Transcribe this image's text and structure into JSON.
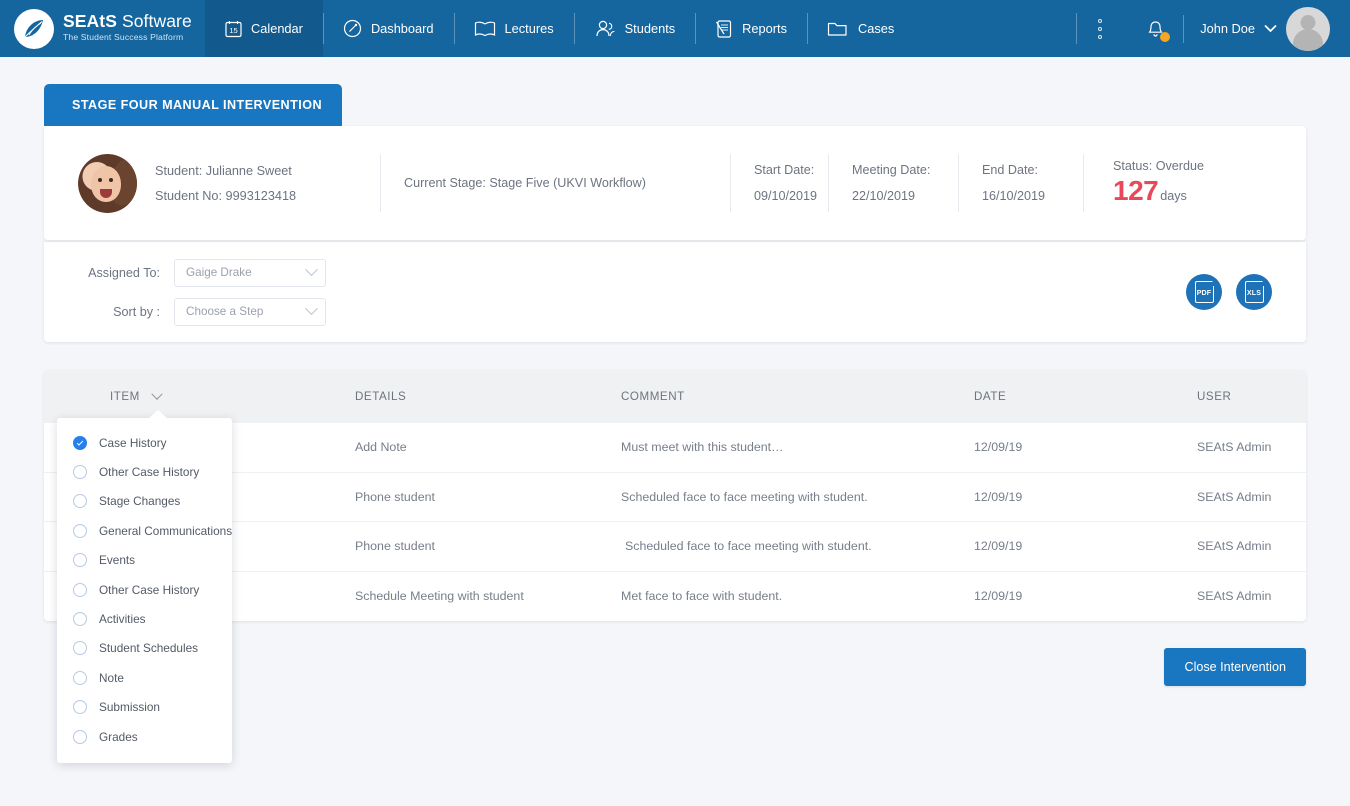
{
  "brand": {
    "name_bold": "SEAtS",
    "name_light": " Software",
    "tagline": "The Student Success Platform"
  },
  "nav": {
    "items": [
      {
        "label": "Calendar",
        "icon": "calendar-icon",
        "active": true
      },
      {
        "label": "Dashboard",
        "icon": "gauge-icon",
        "active": false
      },
      {
        "label": "Lectures",
        "icon": "book-icon",
        "active": false
      },
      {
        "label": "Students",
        "icon": "people-icon",
        "active": false
      },
      {
        "label": "Reports",
        "icon": "report-icon",
        "active": false
      },
      {
        "label": "Cases",
        "icon": "folder-icon",
        "active": false
      }
    ],
    "calendar_day": "15",
    "user_name": "John Doe",
    "accent_blue": "#15659f",
    "badge_color": "#f5a623"
  },
  "banner": {
    "title": "STAGE FOUR MANUAL INTERVENTION"
  },
  "student_info": {
    "student": "Student: Julianne Sweet",
    "student_no": "Student No: 9993123418",
    "current_stage": "Current Stage: Stage Five (UKVI Workflow)",
    "start_date_label": "Start Date:",
    "start_date": "09/10/2019",
    "meeting_date_label": "Meeting Date:",
    "meeting_date": "22/10/2019",
    "end_date_label": "End Date:",
    "end_date": "16/10/2019",
    "status_label": "Status: Overdue",
    "overdue_number": "127",
    "overdue_unit": "days",
    "overdue_color": "#e8495a"
  },
  "filters": {
    "assigned_to_label": "Assigned To:",
    "assigned_to_value": "Gaige Drake",
    "sort_by_label": "Sort by :",
    "sort_by_value": "Choose a Step",
    "export_pdf": "PDF",
    "export_xls": "XLS"
  },
  "table": {
    "columns": [
      "ITEM",
      "DETAILS",
      "COMMENT",
      "DATE",
      "USER"
    ],
    "rows": [
      {
        "item": "",
        "details": "Add Note",
        "comment": "Must meet with this student…",
        "date": "12/09/19",
        "user": "SEAtS Admin"
      },
      {
        "item": "",
        "details": "Phone student",
        "comment": "Scheduled face to face meeting with student.",
        "date": "12/09/19",
        "user": "SEAtS Admin"
      },
      {
        "item": "",
        "details": "Phone student",
        "comment": "Scheduled face to face meeting with student.",
        "date": "12/09/19",
        "user": "SEAtS Admin"
      },
      {
        "item": "",
        "details": "Schedule Meeting with student",
        "comment": "Met face to face with student.",
        "date": "12/09/19",
        "user": "SEAtS Admin"
      }
    ]
  },
  "item_dropdown": {
    "options": [
      {
        "label": "Case History",
        "selected": true
      },
      {
        "label": "Other Case History",
        "selected": false
      },
      {
        "label": "Stage Changes",
        "selected": false
      },
      {
        "label": "General Communications",
        "selected": false
      },
      {
        "label": "Events",
        "selected": false
      },
      {
        "label": "Other Case History",
        "selected": false
      },
      {
        "label": "Activities",
        "selected": false
      },
      {
        "label": "Student Schedules",
        "selected": false
      },
      {
        "label": "Note",
        "selected": false
      },
      {
        "label": "Submission",
        "selected": false
      },
      {
        "label": "Grades",
        "selected": false
      }
    ],
    "selected_color": "#2680eb"
  },
  "footer": {
    "close_intervention": "Close Intervention"
  }
}
